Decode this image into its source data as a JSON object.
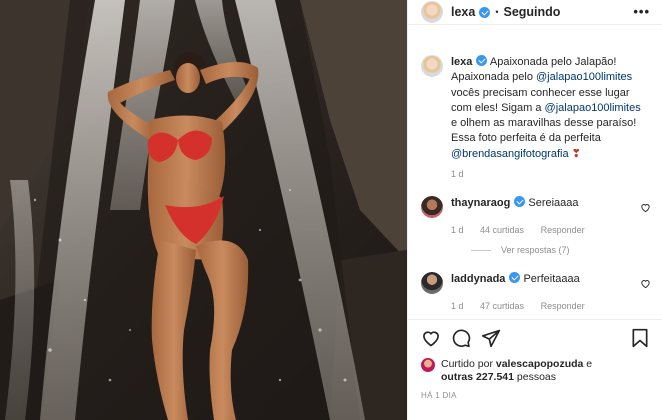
{
  "post": {
    "author": "lexa",
    "follow_label": "Seguindo",
    "more_label": "•••",
    "separator": "•",
    "caption": {
      "author": "lexa",
      "text_1": "Apaixonada pelo Jalapão! Apaixonada pelo ",
      "mention_1": "@jalapao100limites",
      "text_2": " vocês precisam conhecer esse lugar com eles! Sigam a ",
      "mention_2": "@jalapao100limites",
      "text_3": " e olhem as maravilhas desse paraíso! Essa foto perfeita é da perfeita ",
      "mention_3": "@brendasangifotografia",
      "emoji": "❣"
    },
    "caption_time": "1 d"
  },
  "comments": [
    {
      "user": "thaynaraog",
      "text": "Sereiaaaa",
      "time": "1 d",
      "likes": "44 curtidas",
      "reply": "Responder",
      "view_replies": "Ver respostas (7)"
    },
    {
      "user": "laddynada",
      "text": "Perfeitaaaa",
      "time": "1 d",
      "likes": "47 curtidas",
      "reply": "Responder"
    }
  ],
  "likes_line": {
    "prefix": "Curtido por ",
    "user": "valescapopozuda",
    "mid": " e",
    "outras": "outras ",
    "count": "227.541",
    "suffix": " pessoas"
  },
  "time_ago": "HÁ 1 DIA",
  "icons": {
    "like": "heart-icon",
    "comment": "comment-icon",
    "share": "share-icon",
    "save": "bookmark-icon"
  },
  "colors": {
    "verified": "#3897f0",
    "mention": "#00376b",
    "muted": "#8e8e8e",
    "bikini": "#d4312c"
  }
}
